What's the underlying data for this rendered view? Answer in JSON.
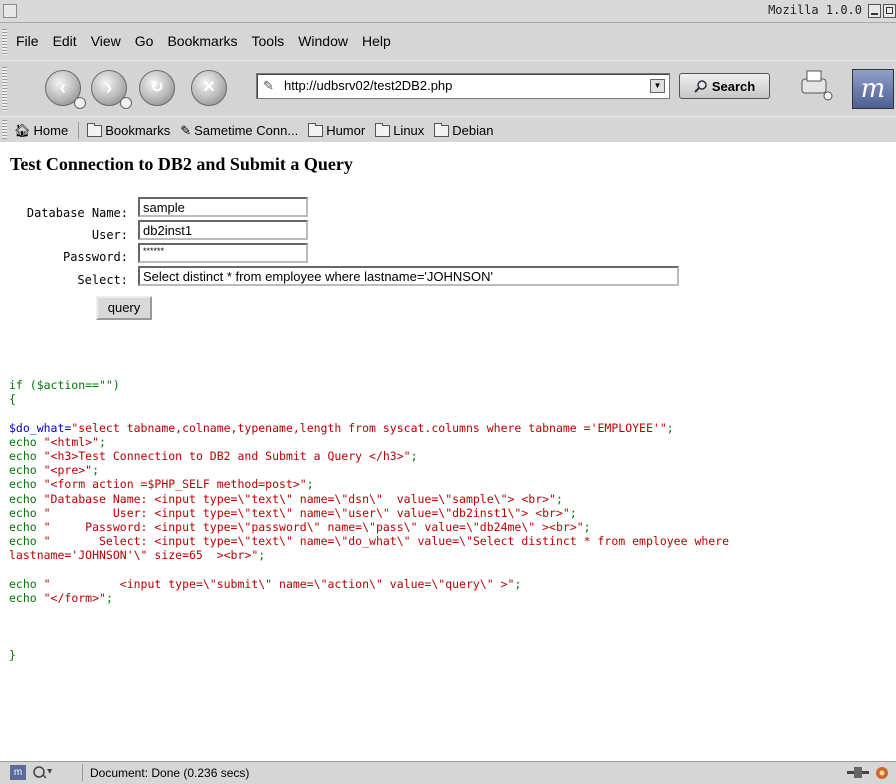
{
  "window": {
    "title": "Mozilla 1.0.0"
  },
  "menu": [
    "File",
    "Edit",
    "View",
    "Go",
    "Bookmarks",
    "Tools",
    "Window",
    "Help"
  ],
  "nav": {
    "url": "http://udbsrv02/test2DB2.php",
    "search_label": "Search",
    "icons": [
      "back-icon",
      "forward-icon",
      "reload-icon",
      "stop-icon",
      "print-icon",
      "mozilla-logo"
    ]
  },
  "personal_toolbar": {
    "home": "Home",
    "items": [
      "Bookmarks",
      "Sametime Conn...",
      "Humor",
      "Linux",
      "Debian"
    ]
  },
  "page": {
    "heading": "Test Connection to DB2 and Submit a Query",
    "form": {
      "db_label": "Database Name:",
      "db_value": "sample",
      "user_label": "User:",
      "user_value": "db2inst1",
      "password_label": "Password:",
      "password_value": "******",
      "select_label": "Select:",
      "select_value": "Select distinct * from employee where lastname='JOHNSON'",
      "submit_label": "query"
    },
    "code": {
      "l1": "if ($action==\"\")",
      "l2": "{",
      "l3a": "$do_what=",
      "l3b": "\"select tabname,colname,typename,length from syscat.columns where tabname ='EMPLOYEE'\"",
      "l4a": "echo ",
      "l4b": "\"<html>\"",
      "l5b": "\"<h3>Test Connection to DB2 and Submit a Query </h3>\"",
      "l6b": "\"<pre>\"",
      "l7b": "\"<form action =$PHP_SELF method=post>\"",
      "l8b": "\"Database Name: <input type=\\\"text\\\" name=\\\"dsn\\\"  value=\\\"sample\\\"> <br>\"",
      "l9b": "\"         User: <input type=\\\"text\\\" name=\\\"user\\\" value=\\\"db2inst1\\\"> <br>\"",
      "l10b": "\"     Password: <input type=\\\"password\\\" name=\\\"pass\\\" value=\\\"db24me\\\" ><br>\"",
      "l11b": "\"       Select: <input type=\\\"text\\\" name=\\\"do_what\\\" value=\\\"Select distinct * from employee where",
      "l12": "lastname='JOHNSON'\\\" size=65  ><br>\"",
      "l13b": "\"          <input type=\\\"submit\\\" name=\\\"action\\\" value=\\\"query\\\" >\"",
      "l14b": "\"</form>\"",
      "semi": ";",
      "l15": "}"
    }
  },
  "status": {
    "text": "Document: Done (0.236 secs)"
  }
}
